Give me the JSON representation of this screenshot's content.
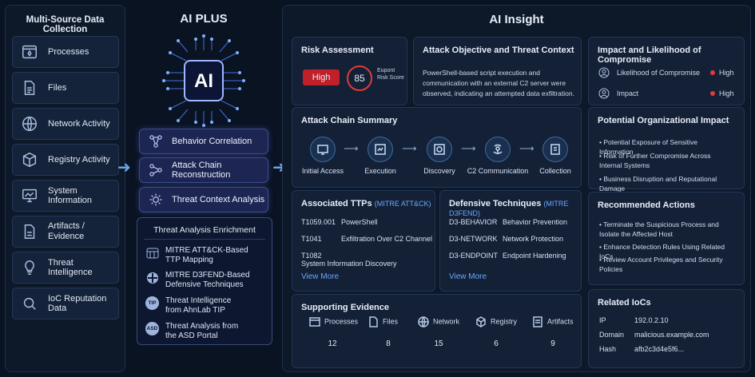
{
  "col1": {
    "title": "Multi-Source Data Collection",
    "items": [
      {
        "label": "Processes",
        "icon": "processes-icon"
      },
      {
        "label": "Files",
        "icon": "file-icon"
      },
      {
        "label": "Network Activity",
        "icon": "globe-icon"
      },
      {
        "label": "Registry Activity",
        "icon": "registry-cube-icon"
      },
      {
        "label": "System Information",
        "icon": "monitor-icon"
      },
      {
        "label": "Artifacts / Evidence",
        "icon": "artifact-file-icon"
      },
      {
        "label": "Threat Intelligence",
        "icon": "lightbulb-icon"
      },
      {
        "label": "IoC Reputation Data",
        "icon": "magnifier-icon"
      }
    ]
  },
  "col2": {
    "title": "AI PLUS",
    "chip": "AI",
    "processes": [
      {
        "label": "Behavior Correlation"
      },
      {
        "label": "Attack Chain Reconstruction"
      },
      {
        "label": "Threat Context Analysis"
      }
    ],
    "enrichment": {
      "title": "Threat Analysis Enrichment",
      "items": [
        {
          "badge": "",
          "label": "MITRE ATT&CK-Based TTP Mapping"
        },
        {
          "badge": "",
          "label": "MITRE D3FEND-Based Defensive Techniques"
        },
        {
          "badge": "TIP",
          "label": "Threat Intelligence from AhnLab TIP"
        },
        {
          "badge": "ASD",
          "label": "Threat Analysis from the ASD Portal"
        }
      ]
    }
  },
  "col3": {
    "title": "AI Insight",
    "risk": {
      "title": "Risk Assessment",
      "level": "High",
      "score": "85",
      "score_label": "Eupont Risk Score"
    },
    "objective": {
      "title": "Attack Objective and Threat Context",
      "text": "PowerShell-based script execution and communication with an external C2 server were observed, indicating an attempted data exfiltration."
    },
    "impact": {
      "title": "Impact and Likelihood of Compromise",
      "rows": [
        {
          "label": "Likelihood of Compromise",
          "value": "High"
        },
        {
          "label": "Impact",
          "value": "High"
        }
      ]
    },
    "chain": {
      "title": "Attack Chain Summary",
      "steps": [
        "Initial Access",
        "Execution",
        "Discovery",
        "C2 Communication",
        "Collection"
      ]
    },
    "org": {
      "title": "Potential Organizational Impact",
      "items": [
        "Potential Exposure of Sensitive Information",
        "Risk of Further Compromise Across Internal Systems",
        "Business Disruption and Reputational Damage"
      ]
    },
    "ttps": {
      "title": "Associated TTPs",
      "tag": "(MITRE ATT&CK)",
      "rows": [
        [
          "T1059.001",
          "PowerShell"
        ],
        [
          "T1041",
          "Exfiltration Over C2 Channel"
        ],
        [
          "T1082",
          "System Information Discovery"
        ]
      ],
      "link": "View More"
    },
    "defense": {
      "title": "Defensive Techniques",
      "tag": "(MITRE D3FEND)",
      "rows": [
        [
          "D3-BEHAVIOR",
          "Behavior Prevention"
        ],
        [
          "D3-NETWORK",
          "Network Protection"
        ],
        [
          "D3-ENDPOINT",
          "Endpoint Hardening"
        ]
      ],
      "link": "View More"
    },
    "actions": {
      "title": "Recommended Actions",
      "items": [
        "Terminate the Suspicious Process and Isolate the Affected Host",
        "Enhance Detection Rules Using Related IoCs",
        "Review Account Privileges and Security Policies"
      ]
    },
    "evidence": {
      "title": "Supporting Evidence",
      "items": [
        {
          "label": "Processes",
          "value": "12"
        },
        {
          "label": "Files",
          "value": "8"
        },
        {
          "label": "Network",
          "value": "15"
        },
        {
          "label": "Registry",
          "value": "6"
        },
        {
          "label": "Artifacts",
          "value": "9"
        }
      ]
    },
    "iocs": {
      "title": "Related IoCs",
      "rows": [
        [
          "IP",
          "192.0.2.10"
        ],
        [
          "Domain",
          "malicious.example.com"
        ],
        [
          "Hash",
          "afb2c3d4e5f6..."
        ]
      ]
    }
  },
  "colors": {
    "high": "#c0202a",
    "accent": "#6aa8ff"
  }
}
